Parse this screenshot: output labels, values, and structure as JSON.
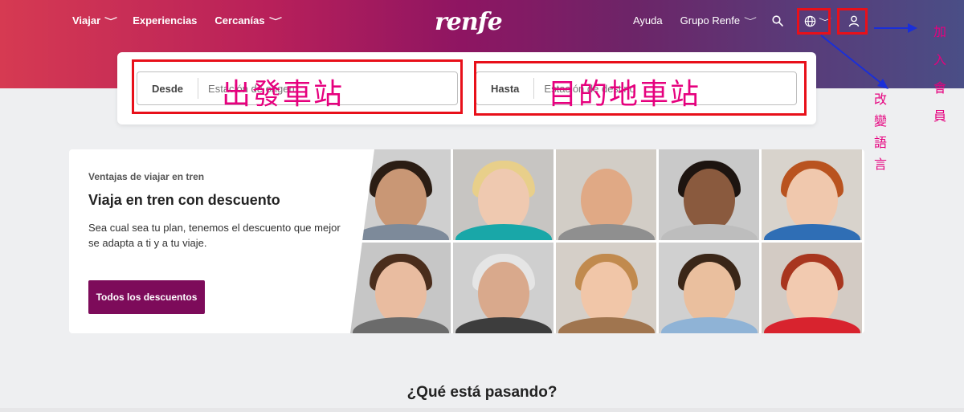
{
  "header": {
    "logo": "renfe",
    "nav_left": [
      {
        "label": "Viajar",
        "has_dropdown": true
      },
      {
        "label": "Experiencias",
        "has_dropdown": false
      },
      {
        "label": "Cercanías",
        "has_dropdown": true
      }
    ],
    "nav_right": {
      "ayuda": "Ayuda",
      "grupo": "Grupo Renfe"
    },
    "icons": [
      "search-icon",
      "globe-icon",
      "chevron-down-icon",
      "user-icon"
    ]
  },
  "search": {
    "from_label": "Desde",
    "from_placeholder": "Estación de origen",
    "to_label": "Hasta",
    "to_placeholder": "Estación de destino"
  },
  "annotations": {
    "from": "出發車站",
    "to": "目的地車站",
    "language": "改變語言",
    "join": "加入會員"
  },
  "promo": {
    "eyebrow": "Ventajas de viajar en tren",
    "title": "Viaja en tren con descuento",
    "description": "Sea cual sea tu plan, tenemos el descuento que mejor se adapta a ti y a tu viaje.",
    "cta": "Todos los descuentos"
  },
  "section": {
    "title": "¿Qué está pasando?"
  },
  "colors": {
    "accent": "#7d0b5a",
    "annotation_box": "#e8101a",
    "annotation_text": "#e6007e",
    "annotation_arrow": "#1a2fd8"
  }
}
